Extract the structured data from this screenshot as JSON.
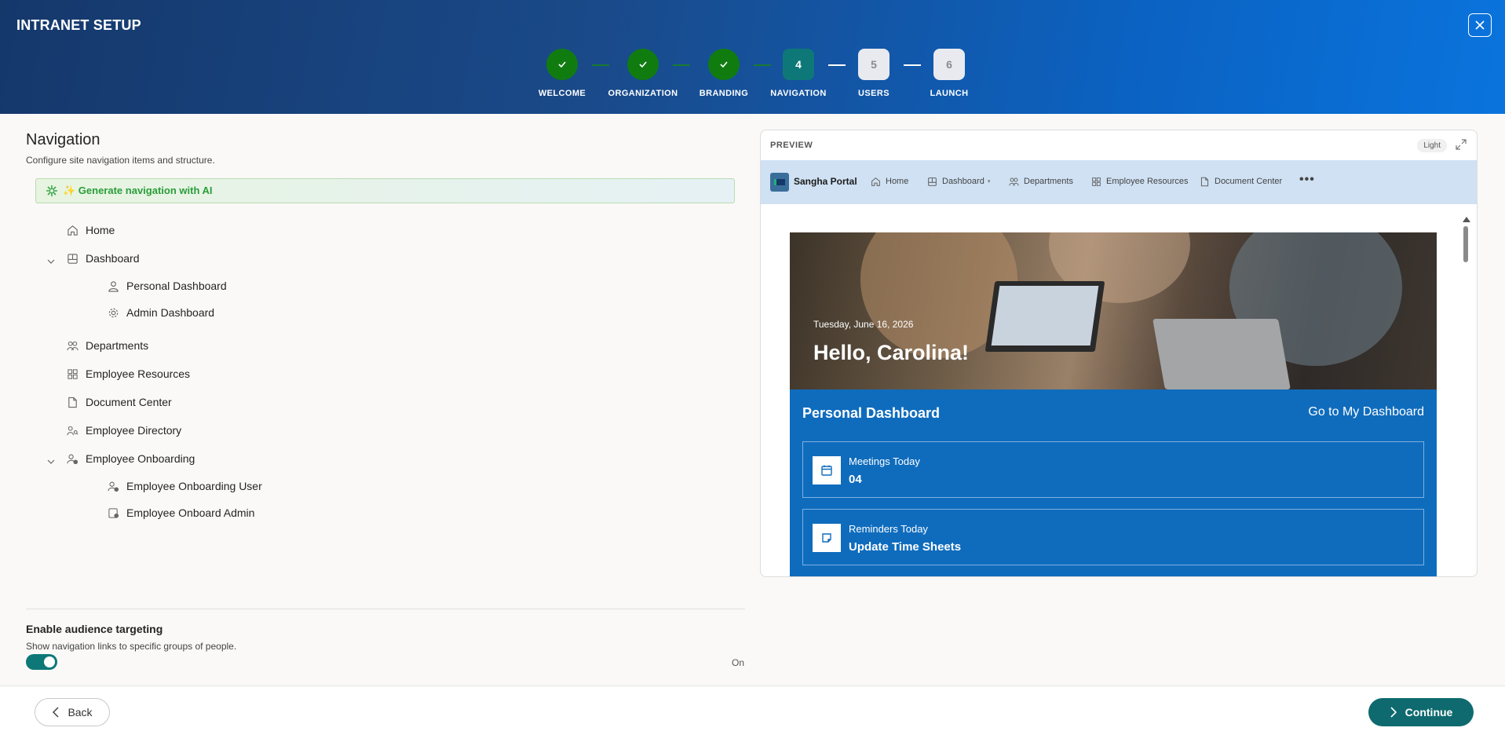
{
  "header": {
    "title": "INTRANET SETUP",
    "steps": [
      {
        "number": "✓",
        "label": "WELCOME",
        "status": "complete"
      },
      {
        "number": "✓",
        "label": "ORGANIZATION",
        "status": "complete"
      },
      {
        "number": "✓",
        "label": "BRANDING",
        "status": "complete"
      },
      {
        "number": "4",
        "label": "NAVIGATION",
        "status": "active"
      },
      {
        "number": "5",
        "label": "USERS",
        "status": "pending"
      },
      {
        "number": "6",
        "label": "LAUNCH",
        "status": "pending"
      }
    ]
  },
  "main": {
    "title": "Navigation",
    "subtitle": "Configure site navigation items and structure.",
    "ai_button": "✨ Generate navigation with AI",
    "nav_items": [
      {
        "label": "Home",
        "icon": "home-icon"
      },
      {
        "label": "Dashboard",
        "icon": "dashboard-icon",
        "expanded": true
      },
      {
        "label": "Personal Dashboard",
        "icon": "person-icon",
        "child": true
      },
      {
        "label": "Admin Dashboard",
        "icon": "gear-icon",
        "child": true
      },
      {
        "label": "Departments",
        "icon": "people-icon"
      },
      {
        "label": "Employee Resources",
        "icon": "apps-icon"
      },
      {
        "label": "Document Center",
        "icon": "document-icon"
      },
      {
        "label": "Employee Directory",
        "icon": "directory-icon"
      },
      {
        "label": "Employee Onboarding",
        "icon": "onboarding-icon",
        "expanded": true
      },
      {
        "label": "Employee Onboarding User",
        "icon": "onboarding-user-icon",
        "child": true
      },
      {
        "label": "Employee Onboard Admin",
        "icon": "onboard-admin-icon",
        "child": true
      }
    ],
    "audience": {
      "title": "Enable audience targeting",
      "subtitle": "Show navigation links to specific groups of people.",
      "toggle_state": "On",
      "enabled": true
    }
  },
  "preview": {
    "label": "PREVIEW",
    "theme": "Light",
    "site_name": "Sangha Portal",
    "links": [
      "Home",
      "Dashboard",
      "Departments",
      "Employee Resources",
      "Document Center"
    ],
    "more": "•••",
    "hero_date": "Tuesday, June 16, 2026",
    "hero_greeting": "Hello, Carolina!",
    "section_title": "Personal Dashboard",
    "section_link": "Go to My Dashboard",
    "cards": [
      {
        "title": "Meetings Today",
        "value": "04",
        "icon": "calendar-icon"
      },
      {
        "title": "Reminders Today",
        "value": "Update Time Sheets",
        "icon": "note-icon"
      }
    ]
  },
  "footer": {
    "back_label": "Back",
    "continue_label": "Continue"
  },
  "colors": {
    "complete": "#107c10",
    "active": "#0e7878",
    "primary_button": "#0e6a6e",
    "dashboard_blue": "#0f6cbd"
  }
}
